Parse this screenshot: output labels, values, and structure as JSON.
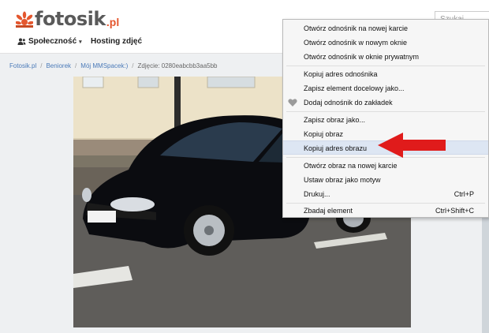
{
  "site": {
    "logo_text": "fotosik",
    "logo_tld": ".pl",
    "search_placeholder": "Szukaj"
  },
  "nav": {
    "community_label": "Społeczność",
    "hosting_label": "Hosting zdjęć"
  },
  "breadcrumb": {
    "items": [
      "Fotosik.pl",
      "Beniorek",
      "Mój MMSpacek:)"
    ],
    "current": "Zdjęcie: 0280eabcbb3aa5bb"
  },
  "context_menu": {
    "items": [
      {
        "label": "Otwórz odnośnik na nowej karcie"
      },
      {
        "label": "Otwórz odnośnik w nowym oknie"
      },
      {
        "label": "Otwórz odnośnik w oknie prywatnym"
      },
      {
        "label": "Kopiuj adres odnośnika"
      },
      {
        "label": "Zapisz element docelowy jako..."
      },
      {
        "label": "Dodaj odnośnik do zakładek",
        "icon": "heart-icon"
      },
      {
        "label": "Zapisz obraz jako..."
      },
      {
        "label": "Kopiuj obraz"
      },
      {
        "label": "Kopiuj adres obrazu",
        "highlighted": true
      },
      {
        "label": "Otwórz obraz na nowej karcie"
      },
      {
        "label": "Ustaw obraz jako motyw"
      },
      {
        "label": "Drukuj...",
        "shortcut": "Ctrl+P"
      },
      {
        "label": "Zbadaj element",
        "shortcut": "Ctrl+Shift+C"
      }
    ]
  },
  "colors": {
    "accent": "#e4572e",
    "link": "#4a7ab8",
    "highlight": "#dde6f3",
    "arrow": "#e01b1b"
  }
}
